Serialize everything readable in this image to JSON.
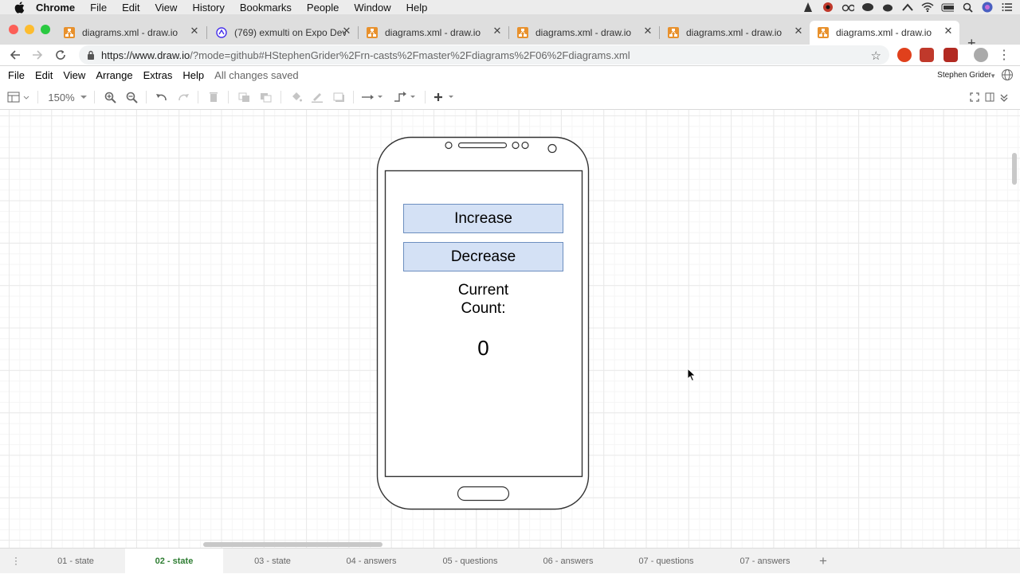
{
  "mac_menu": {
    "items": [
      "Chrome",
      "File",
      "Edit",
      "View",
      "History",
      "Bookmarks",
      "People",
      "Window",
      "Help"
    ]
  },
  "tabs": [
    {
      "title": "diagrams.xml - draw.io",
      "active": false
    },
    {
      "title": "(769) exmulti on Expo Dev",
      "active": false
    },
    {
      "title": "diagrams.xml - draw.io",
      "active": false
    },
    {
      "title": "diagrams.xml - draw.io",
      "active": false
    },
    {
      "title": "diagrams.xml - draw.io",
      "active": false
    },
    {
      "title": "diagrams.xml - draw.io",
      "active": true
    }
  ],
  "address": {
    "host": "https://www.draw.io",
    "path": "/?mode=github#HStephenGrider%2Frn-casts%2Fmaster%2Fdiagrams%2F06%2Fdiagrams.xml"
  },
  "app_menu": {
    "items": [
      "File",
      "Edit",
      "View",
      "Arrange",
      "Extras",
      "Help"
    ],
    "status": "All changes saved",
    "user": "Stephen Grider"
  },
  "toolbar": {
    "zoom": "150%"
  },
  "diagram": {
    "increase_label": "Increase",
    "decrease_label": "Decrease",
    "count_label_line1": "Current",
    "count_label_line2": "Count:",
    "count_value": "0"
  },
  "pages": [
    {
      "label": "01 - state",
      "active": false
    },
    {
      "label": "02 - state",
      "active": true
    },
    {
      "label": "03 - state",
      "active": false
    },
    {
      "label": "04 - answers",
      "active": false
    },
    {
      "label": "05 - questions",
      "active": false
    },
    {
      "label": "06 - answers",
      "active": false
    },
    {
      "label": "07 - questions",
      "active": false
    },
    {
      "label": "07 - answers",
      "active": false
    }
  ],
  "colors": {
    "button_fill": "#d4e1f5",
    "button_stroke": "#6c8ebf",
    "active_page": "#2e7d32",
    "favicon": "#e8912d"
  }
}
